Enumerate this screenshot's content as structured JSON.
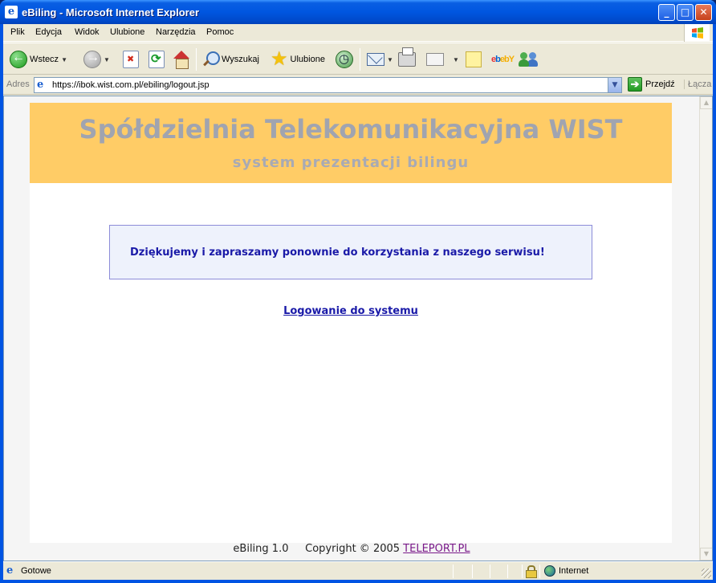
{
  "window": {
    "title": "eBiling - Microsoft Internet Explorer",
    "buttons": {
      "minimize": "_",
      "maximize": "□",
      "close": "✕"
    }
  },
  "menu": {
    "items": [
      {
        "label": "Plik"
      },
      {
        "label": "Edycja"
      },
      {
        "label": "Widok"
      },
      {
        "label": "Ulubione"
      },
      {
        "label": "Narzędzia"
      },
      {
        "label": "Pomoc"
      }
    ]
  },
  "toolbar": {
    "back_label": "Wstecz",
    "search_label": "Wyszukaj",
    "favorites_label": "Ulubione",
    "ebay_label": "ebY"
  },
  "address": {
    "label": "Adres",
    "url": "https://ibok.wist.com.pl/ebiling/logout.jsp",
    "go_label": "Przejdź",
    "links_label": "Łącza"
  },
  "page": {
    "banner_title": "Spółdzielnia Telekomunikacyjna WIST",
    "banner_subtitle": "system prezentacji bilingu",
    "message": "Dziękujemy i zapraszamy ponownie do korzystania z naszego serwisu!",
    "login_link": "Logowanie do systemu",
    "footer_app": "eBiling 1.0",
    "footer_copyright": "Copyright © 2005",
    "footer_link": "TELEPORT.PL",
    "colors": {
      "banner_bg": "#ffcc66",
      "banner_text": "#a0a4b0",
      "message_bg": "#eef2fc",
      "message_border": "#8c8cd8",
      "link_color": "#1a1aa8"
    }
  },
  "status": {
    "text": "Gotowe",
    "zone": "Internet"
  }
}
